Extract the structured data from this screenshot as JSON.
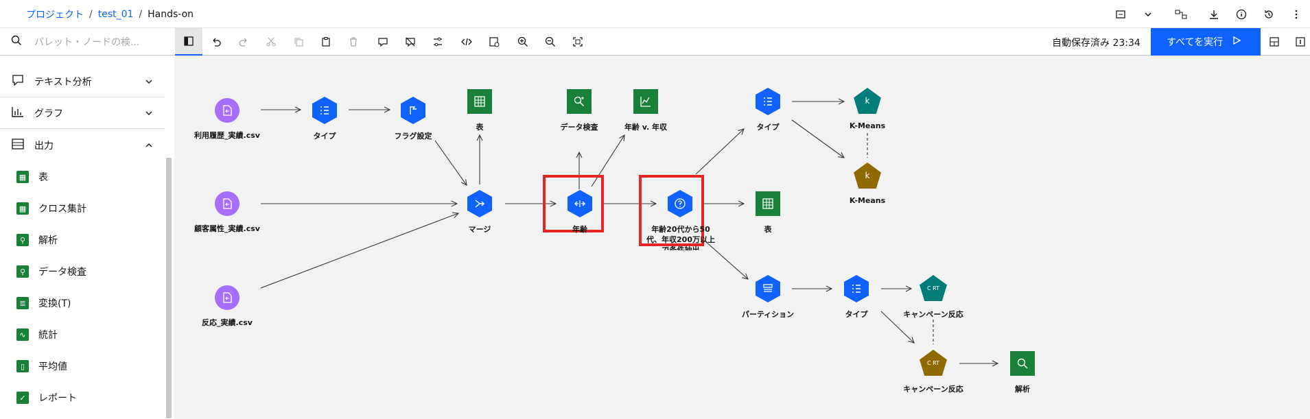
{
  "breadcrumb": {
    "project": "プロジェクト",
    "sep": "/",
    "test": "test_01",
    "current": "Hands-on"
  },
  "toolbar": {
    "search_placeholder": "パレット・ノードの検...",
    "autosave": "自動保存済み 23:34",
    "run_all": "すべてを実行"
  },
  "sidebar": {
    "categories": [
      {
        "label": "テキスト分析",
        "icon": "text-analysis-icon"
      },
      {
        "label": "グラフ",
        "icon": "graph-icon"
      },
      {
        "label": "出力",
        "icon": "output-icon"
      }
    ],
    "items": [
      {
        "label": "表"
      },
      {
        "label": "クロス集計"
      },
      {
        "label": "解析"
      },
      {
        "label": "データ検査"
      },
      {
        "label": "変換(T)"
      },
      {
        "label": "統計"
      },
      {
        "label": "平均値"
      },
      {
        "label": "レポート"
      }
    ]
  },
  "nodes": {
    "usage_csv": "利用履歴_実績.csv",
    "customer_csv": "顧客属性_実績.csv",
    "response_csv": "反応_実績.csv",
    "type1": "タイプ",
    "flag": "フラグ設定",
    "table1": "表",
    "merge": "マージ",
    "data_audit": "データ検査",
    "age_income": "年齢 v. 年収",
    "age": "年齢",
    "select": "年齢20代から50代、年収200万以上で条件抽出",
    "type2": "タイプ",
    "kmeans1": "K-Means",
    "kmeans2": "K-Means",
    "table2": "表",
    "partition": "パーティション",
    "type3": "タイプ",
    "campaign1": "キャンペーン反応",
    "campaign2": "キャンペーン反応",
    "analysis": "解析",
    "kmeans_badge": "k",
    "cart_badge": "C RT"
  },
  "colors": {
    "accent": "#0f62fe",
    "source": "#a56eff",
    "output": "#198038",
    "model_teal": "#007d79",
    "model_gold": "#8e6a00",
    "highlight": "#e62525"
  }
}
